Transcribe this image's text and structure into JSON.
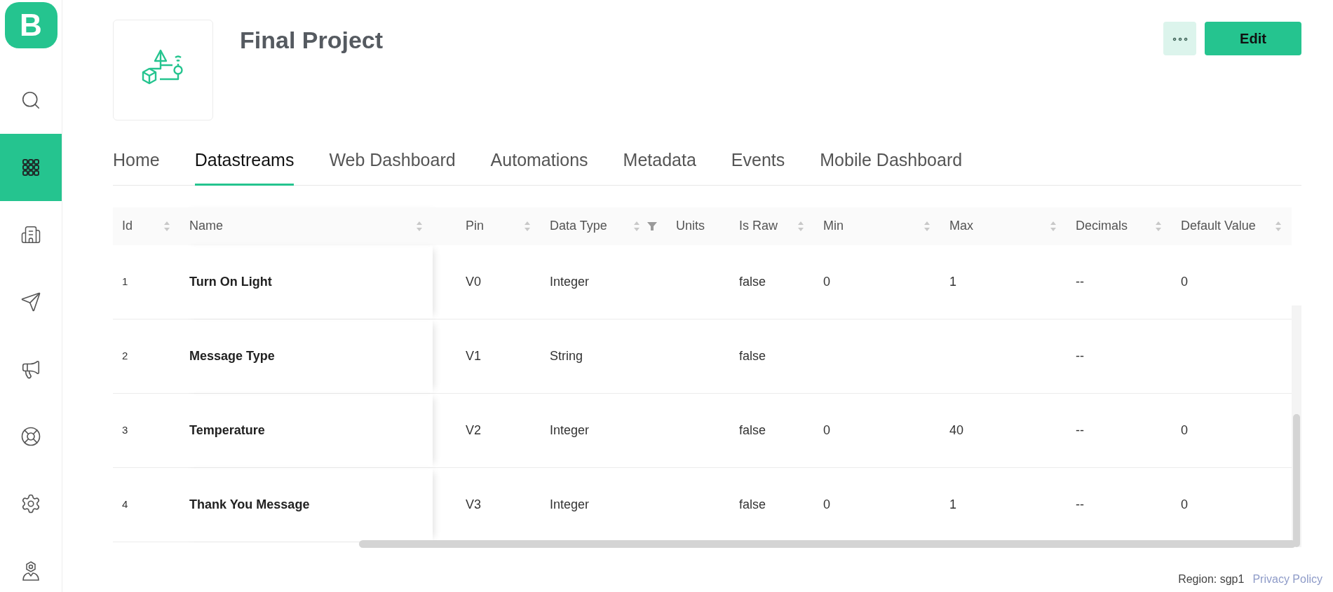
{
  "sidebar": {
    "logo": "B",
    "items": [
      {
        "selected": false
      },
      {
        "selected": true
      },
      {
        "selected": false
      },
      {
        "selected": false
      },
      {
        "selected": false
      },
      {
        "selected": false
      },
      {
        "selected": false
      },
      {
        "selected": false
      }
    ]
  },
  "header": {
    "title": "Final Project",
    "more_button": "∘∘∘",
    "edit_button": "Edit"
  },
  "tabs": [
    {
      "label": "Home",
      "selected": false
    },
    {
      "label": "Datastreams",
      "selected": true
    },
    {
      "label": "Web Dashboard",
      "selected": false
    },
    {
      "label": "Automations",
      "selected": false
    },
    {
      "label": "Metadata",
      "selected": false
    },
    {
      "label": "Events",
      "selected": false
    },
    {
      "label": "Mobile Dashboard",
      "selected": false
    }
  ],
  "table": {
    "columns": [
      {
        "label": "Id",
        "sortable": true,
        "filter": false
      },
      {
        "label": "Name",
        "sortable": true,
        "filter": false
      },
      {
        "label": "Pin",
        "sortable": true,
        "filter": false
      },
      {
        "label": "Data Type",
        "sortable": true,
        "filter": true
      },
      {
        "label": "Units",
        "sortable": false,
        "filter": false
      },
      {
        "label": "Is Raw",
        "sortable": true,
        "filter": false
      },
      {
        "label": "Min",
        "sortable": true,
        "filter": false
      },
      {
        "label": "Max",
        "sortable": true,
        "filter": false
      },
      {
        "label": "Decimals",
        "sortable": true,
        "filter": false
      },
      {
        "label": "Default Value",
        "sortable": true,
        "filter": false
      }
    ],
    "rows": [
      [
        "1",
        "Turn On Light",
        "V0",
        "Integer",
        "",
        "false",
        "0",
        "1",
        "--",
        "0"
      ],
      [
        "2",
        "Message Type",
        "V1",
        "String",
        "",
        "false",
        "",
        "",
        "--",
        ""
      ],
      [
        "3",
        "Temperature",
        "V2",
        "Integer",
        "",
        "false",
        "0",
        "40",
        "--",
        "0"
      ],
      [
        "4",
        "Thank You Message",
        "V3",
        "Integer",
        "",
        "false",
        "0",
        "1",
        "--",
        "0"
      ]
    ]
  },
  "footer": {
    "region": "Region: sgp1",
    "privacy_link": "Privacy Policy"
  }
}
